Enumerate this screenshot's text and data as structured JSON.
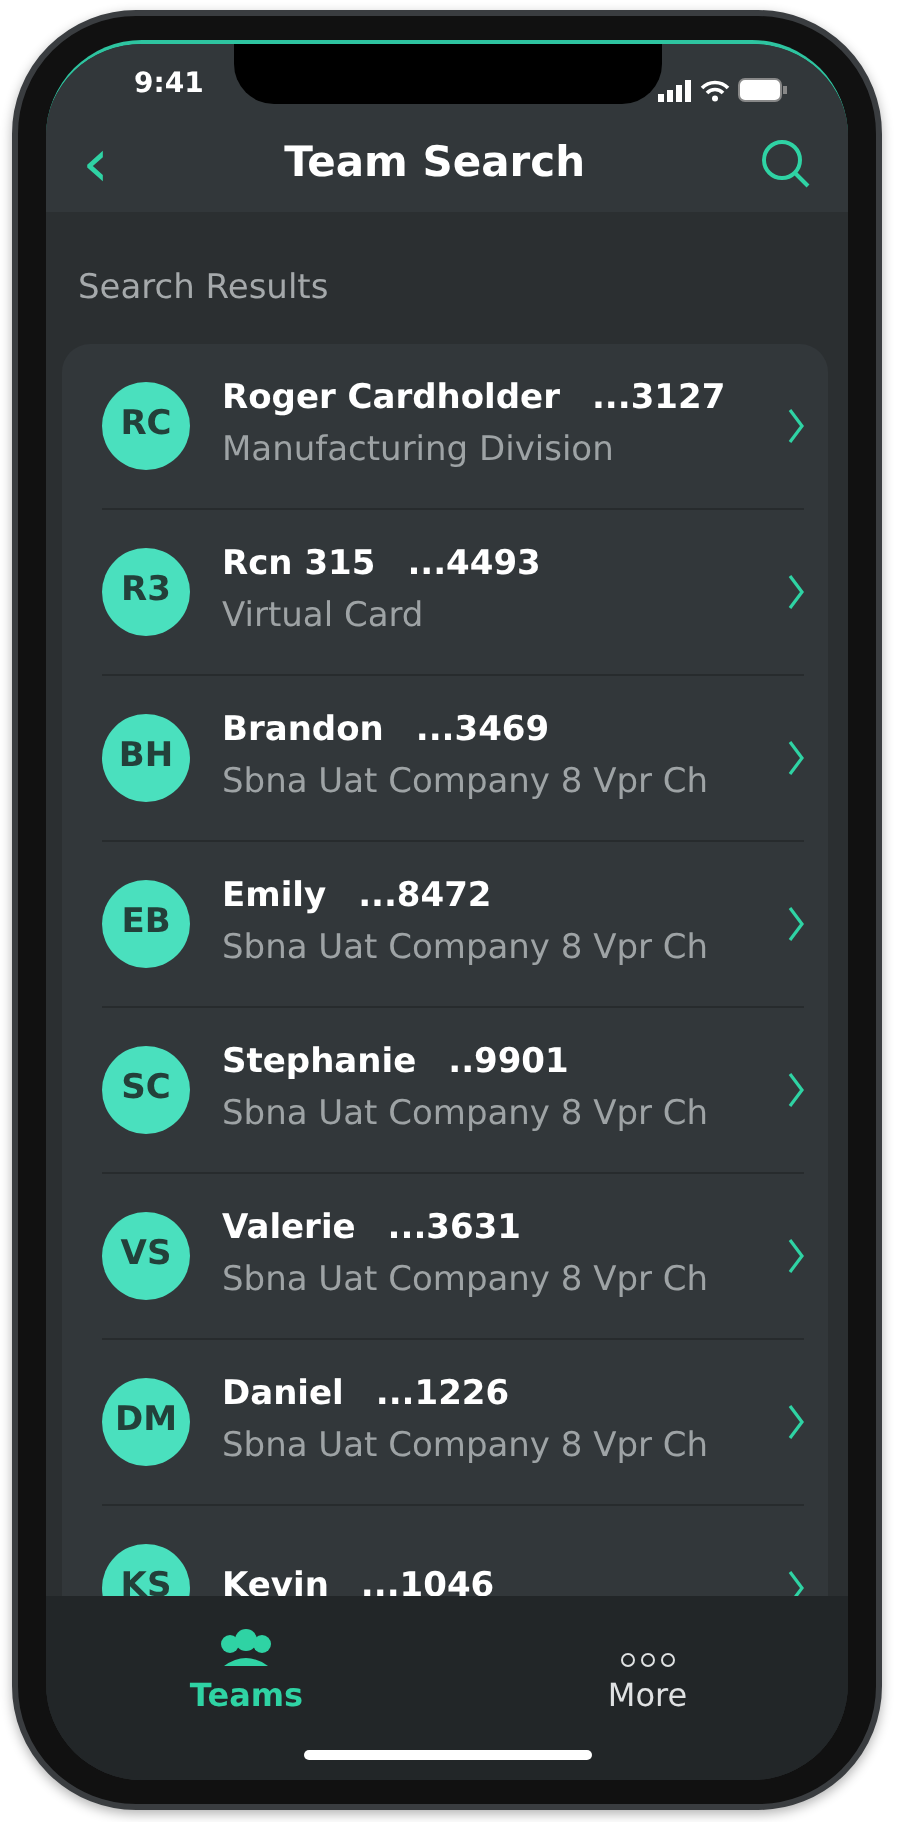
{
  "status_bar": {
    "time": "9:41"
  },
  "header": {
    "back": "‹",
    "title": "Team Search"
  },
  "section_title": "Search Results",
  "results": [
    {
      "initials": "RC",
      "name": "Roger Cardholder",
      "number": "...3127",
      "subtitle": "Manufacturing Division"
    },
    {
      "initials": "R3",
      "name": "Rcn 315",
      "number": "...4493",
      "subtitle": "Virtual Card"
    },
    {
      "initials": "BH",
      "name": "Brandon",
      "number": "...3469",
      "subtitle": "Sbna Uat Company 8 Vpr Ch"
    },
    {
      "initials": "EB",
      "name": "Emily",
      "number": "...8472",
      "subtitle": "Sbna Uat Company 8 Vpr Ch"
    },
    {
      "initials": "SC",
      "name": "Stephanie",
      "number": "..9901",
      "subtitle": "Sbna Uat Company 8 Vpr Ch"
    },
    {
      "initials": "VS",
      "name": "Valerie",
      "number": "...3631",
      "subtitle": "Sbna Uat Company 8 Vpr Ch"
    },
    {
      "initials": "DM",
      "name": "Daniel",
      "number": "...1226",
      "subtitle": "Sbna Uat Company 8 Vpr Ch"
    },
    {
      "initials": "KS",
      "name": "Kevin",
      "number": "...1046"
    }
  ],
  "tabs": [
    {
      "label": "Teams",
      "kind": "teams",
      "selected": true
    },
    {
      "label": "More",
      "kind": "more",
      "selected": false
    }
  ]
}
